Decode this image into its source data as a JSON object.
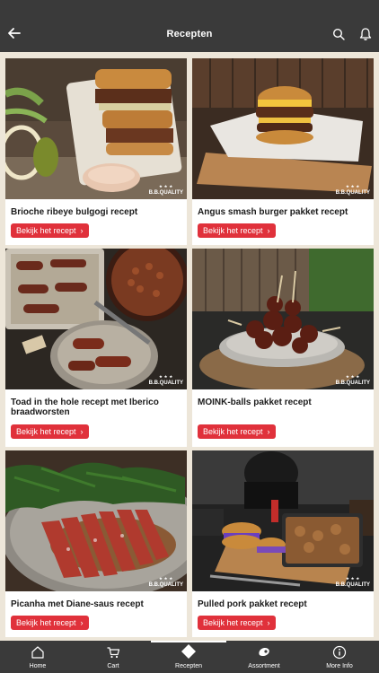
{
  "header": {
    "title": "Recepten"
  },
  "badge": {
    "text": "B.B.QUALITY"
  },
  "recipes": [
    {
      "name": "Brioche ribeye bulgogi recept",
      "button": "Bekijk het recept"
    },
    {
      "name": "Angus smash burger pakket recept",
      "button": "Bekijk het recept"
    },
    {
      "name": "Toad in the hole recept met Iberico braadworsten",
      "button": "Bekijk het recept"
    },
    {
      "name": "MOINK-balls pakket recept",
      "button": "Bekijk het recept"
    },
    {
      "name": "Picanha met Diane-saus recept",
      "button": "Bekijk het recept"
    },
    {
      "name": "Pulled pork pakket recept",
      "button": "Bekijk het recept"
    }
  ],
  "tabs": [
    {
      "label": "Home",
      "icon": "home-icon"
    },
    {
      "label": "Cart",
      "icon": "cart-icon"
    },
    {
      "label": "Recepten",
      "icon": "diamond-icon",
      "active": true
    },
    {
      "label": "Assortment",
      "icon": "meat-icon"
    },
    {
      "label": "More Info",
      "icon": "info-icon"
    }
  ],
  "colors": {
    "topbar": "#3a3a3a",
    "background": "#ede6d9",
    "button": "#e0313b"
  }
}
